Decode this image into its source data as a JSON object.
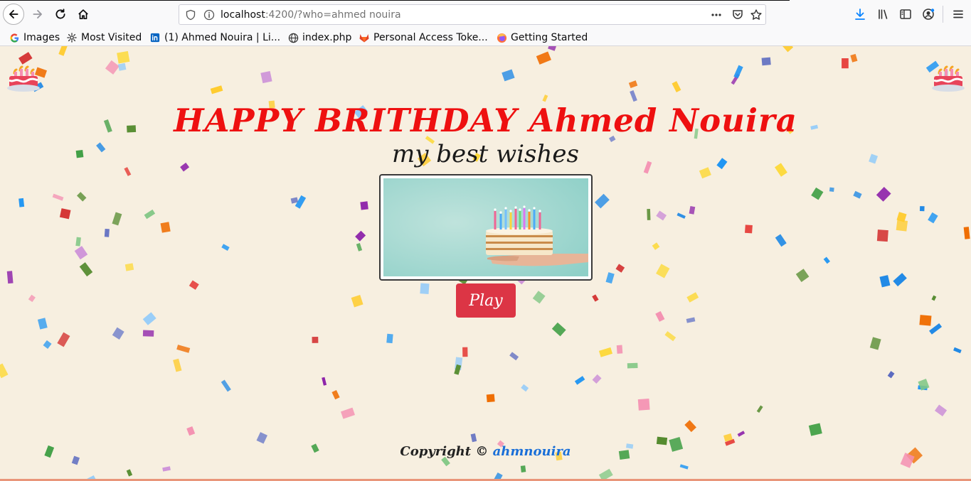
{
  "browser": {
    "url_host": "localhost",
    "url_rest": ":4200/?who=ahmed nouira",
    "bookmarks": [
      {
        "label": "Images",
        "icon": "google-icon"
      },
      {
        "label": "Most Visited",
        "icon": "gear-icon"
      },
      {
        "label": "(1) Ahmed Nouira | Li...",
        "icon": "linkedin-icon"
      },
      {
        "label": "index.php",
        "icon": "globe-icon"
      },
      {
        "label": "Personal Access Toke...",
        "icon": "gitlab-icon"
      },
      {
        "label": "Getting Started",
        "icon": "firefox-icon"
      }
    ]
  },
  "page": {
    "title": "HAPPY BRITHDAY Ahmed Nouira",
    "subtitle": "my best wishes",
    "play_label": "Play",
    "footer_prefix": "Copyright ©",
    "footer_author": "ahmnouira"
  },
  "colors": {
    "title": "#ee1010",
    "play_button": "#dc3545",
    "author_link": "#1a6fd8",
    "background": "#f7efe0"
  }
}
